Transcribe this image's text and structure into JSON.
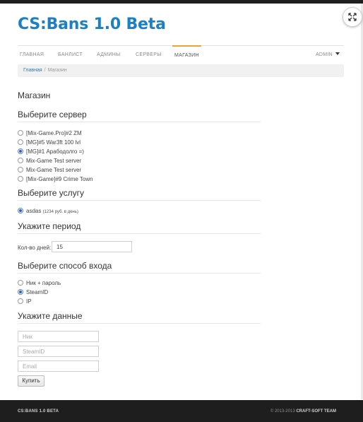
{
  "brand": "CS:Bans 1.0 Beta",
  "nav": {
    "items": [
      "Главная",
      "Банлист",
      "Админы",
      "Серверы",
      "Магазин"
    ],
    "active_index": 4,
    "admin_label": "Admin"
  },
  "breadcrumb": {
    "home": "Главная",
    "separator": "/",
    "current": "Магазин"
  },
  "page_title": "Магазин",
  "servers": {
    "heading": "Выберите сервер",
    "options": [
      "[Mix-Game.Pro]#2 ZM",
      "[MG]#5 War3ft 100 lvl",
      "[MG]#1 Арабодолго =)",
      "Mix-Game Test server",
      "Mix-Game Test server",
      "[Mix-Game]#9 Crime Town"
    ],
    "selected_index": 2
  },
  "services": {
    "heading": "Выберите услугу",
    "option_name": "asdas",
    "option_price": "(1234 руб. в день)",
    "selected": true
  },
  "period": {
    "heading": "Укажите период",
    "label": "Кол-во дней:",
    "value": "15"
  },
  "login": {
    "heading": "Выберите способ входа",
    "options": [
      "Ник + пароль",
      "SteamID",
      "IP"
    ],
    "selected_index": 1
  },
  "details": {
    "heading": "Укажите данные",
    "nick_placeholder": "Ник",
    "steamid_placeholder": "SteamID",
    "email_placeholder": "Email"
  },
  "buy_button": "Купить",
  "footer": {
    "left": "CS:BANS 1.0 BETA",
    "copyright": "© 2013-2013",
    "team": "CRAFT-SOFT TEAM"
  },
  "colors": {
    "brand": "#1b80c4",
    "nav_active": "#f0a23a",
    "footer_bg": "#1e1e1e"
  },
  "icons": {
    "expand": "expand-arrows-icon",
    "admin_caret": "caret-down-icon"
  }
}
